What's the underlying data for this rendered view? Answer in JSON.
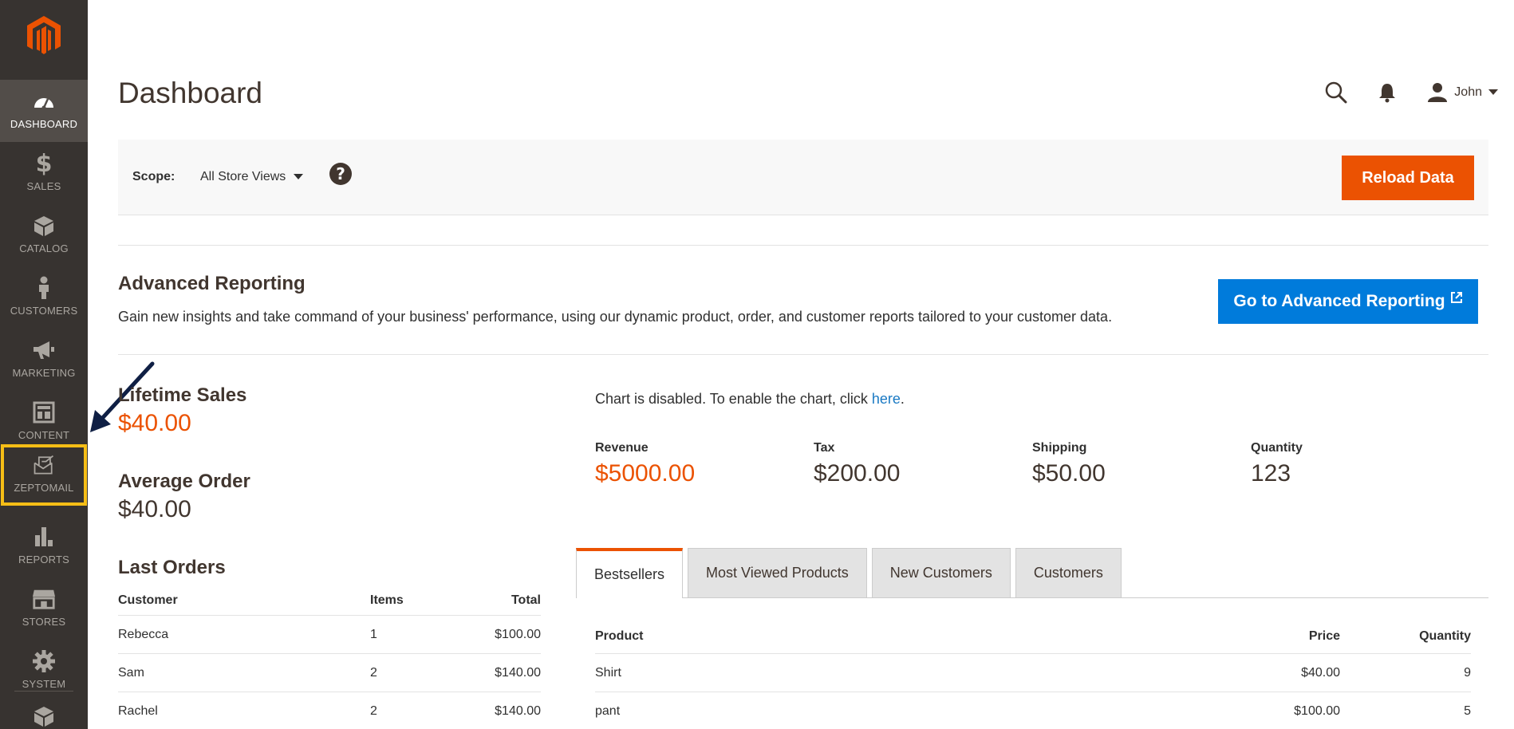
{
  "page": {
    "title": "Dashboard"
  },
  "sidebar": {
    "items": [
      {
        "label": "DASHBOARD",
        "icon": "dashboard-icon"
      },
      {
        "label": "SALES",
        "icon": "dollar-icon"
      },
      {
        "label": "CATALOG",
        "icon": "box-icon"
      },
      {
        "label": "CUSTOMERS",
        "icon": "person-icon"
      },
      {
        "label": "MARKETING",
        "icon": "megaphone-icon"
      },
      {
        "label": "CONTENT",
        "icon": "layout-icon"
      },
      {
        "label": "ZEPTOMAIL",
        "icon": "mail-icon"
      },
      {
        "label": "REPORTS",
        "icon": "bar-chart-icon"
      },
      {
        "label": "STORES",
        "icon": "store-icon"
      },
      {
        "label": "SYSTEM",
        "icon": "gear-icon"
      }
    ]
  },
  "header": {
    "user_name": "John"
  },
  "scope": {
    "label": "Scope:",
    "value": "All Store Views",
    "reload_label": "Reload Data"
  },
  "advanced": {
    "title": "Advanced Reporting",
    "description": "Gain new insights and take command of your business' performance, using our dynamic product, order, and customer reports tailored to your customer data.",
    "button_label": "Go to Advanced Reporting"
  },
  "stats": {
    "lifetime_label": "Lifetime Sales",
    "lifetime_value": "$40.00",
    "avg_label": "Average Order",
    "avg_value": "$40.00"
  },
  "orders": {
    "title": "Last Orders",
    "headers": [
      "Customer",
      "Items",
      "Total"
    ],
    "rows": [
      [
        "Rebecca",
        "1",
        "$100.00"
      ],
      [
        "Sam",
        "2",
        "$140.00"
      ],
      [
        "Rachel",
        "2",
        "$140.00"
      ]
    ]
  },
  "chart": {
    "message": "Chart is disabled. To enable the chart, click ",
    "link": "here",
    "period": "."
  },
  "totals": [
    {
      "label": "Revenue",
      "value": "$5000.00"
    },
    {
      "label": "Tax",
      "value": "$200.00"
    },
    {
      "label": "Shipping",
      "value": "$50.00"
    },
    {
      "label": "Quantity",
      "value": "123"
    }
  ],
  "tabs": [
    "Bestsellers",
    "Most Viewed Products",
    "New Customers",
    "Customers"
  ],
  "products": {
    "headers": [
      "Product",
      "Price",
      "Quantity"
    ],
    "rows": [
      [
        "Shirt",
        "$40.00",
        "9"
      ],
      [
        "pant",
        "$100.00",
        "5"
      ]
    ]
  },
  "colors": {
    "accent": "#eb5202",
    "link": "#1979c3",
    "adv_button": "#007bdb",
    "sidebar": "#373330",
    "highlight": "#f6be16"
  }
}
